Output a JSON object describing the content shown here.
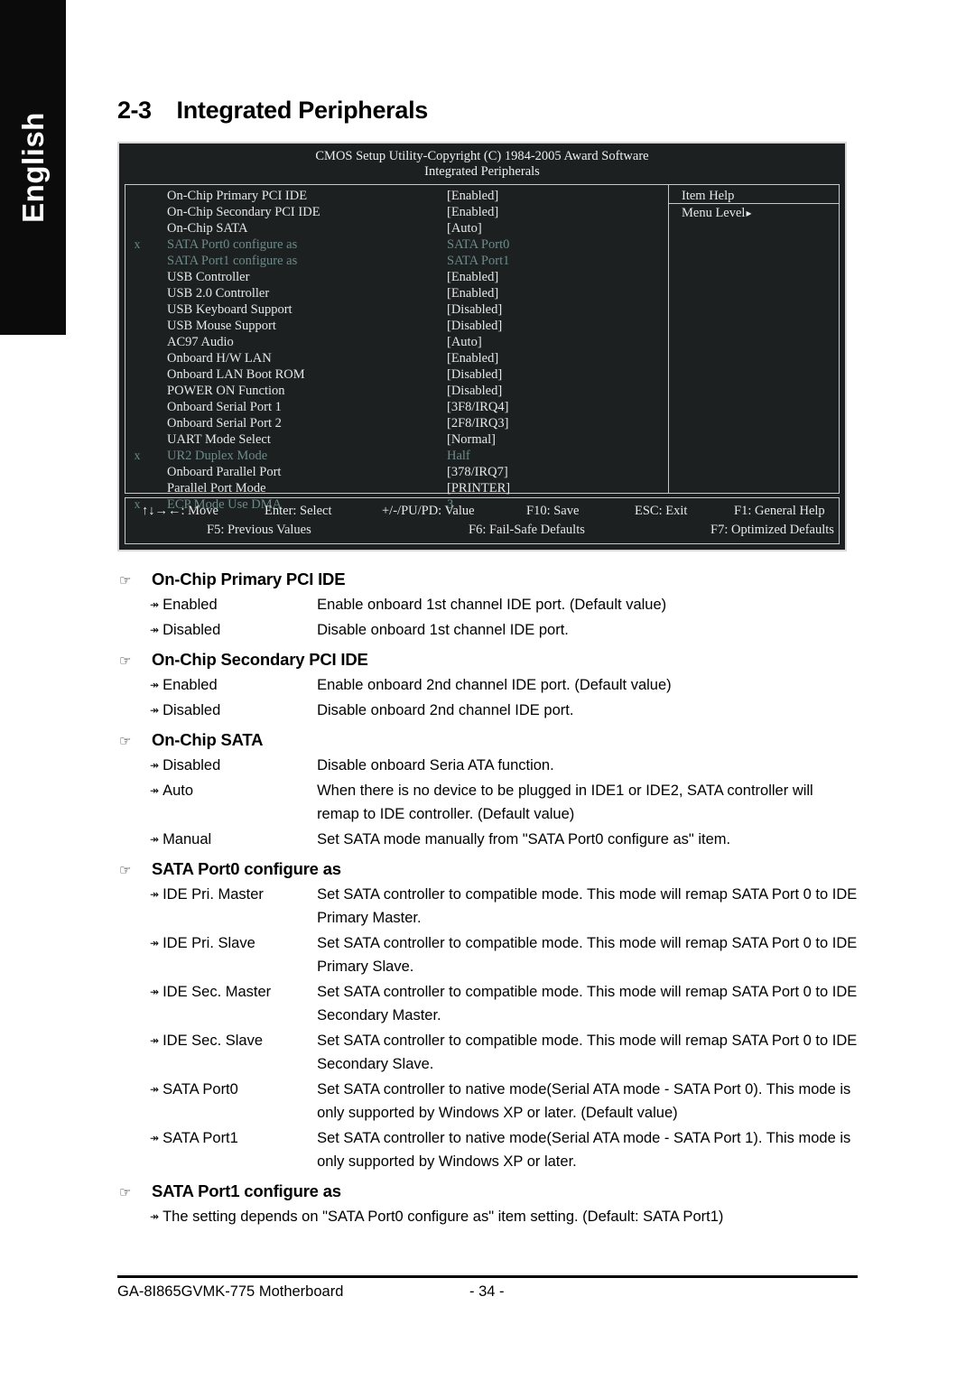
{
  "sidebar": {
    "language_tab": "English"
  },
  "section": {
    "number": "2-3",
    "title": "Integrated Peripherals"
  },
  "bios": {
    "header_line1": "CMOS Setup Utility-Copyright (C) 1984-2005 Award Software",
    "header_line2": "Integrated Peripherals",
    "help_title": "Item Help",
    "help_menu_level": "Menu Level",
    "help_menu_arrow": "▸",
    "rows": [
      {
        "x": "",
        "label": "On-Chip Primary PCI IDE",
        "value": "[Enabled]",
        "dim": false
      },
      {
        "x": "",
        "label": "On-Chip Secondary PCI IDE",
        "value": "[Enabled]",
        "dim": false
      },
      {
        "x": "",
        "label": "On-Chip SATA",
        "value": "[Auto]",
        "dim": false
      },
      {
        "x": "x",
        "label": "SATA Port0 configure as",
        "value": "SATA Port0",
        "dim": true
      },
      {
        "x": "",
        "label": "SATA Port1 configure as",
        "value": "SATA Port1",
        "dim": true
      },
      {
        "x": "",
        "label": "USB Controller",
        "value": "[Enabled]",
        "dim": false
      },
      {
        "x": "",
        "label": "USB 2.0 Controller",
        "value": "[Enabled]",
        "dim": false
      },
      {
        "x": "",
        "label": "USB Keyboard Support",
        "value": "[Disabled]",
        "dim": false
      },
      {
        "x": "",
        "label": "USB Mouse Support",
        "value": "[Disabled]",
        "dim": false
      },
      {
        "x": "",
        "label": "AC97 Audio",
        "value": "[Auto]",
        "dim": false
      },
      {
        "x": "",
        "label": "Onboard H/W LAN",
        "value": "[Enabled]",
        "dim": false
      },
      {
        "x": "",
        "label": "Onboard LAN Boot ROM",
        "value": "[Disabled]",
        "dim": false
      },
      {
        "x": "",
        "label": "POWER ON Function",
        "value": "[Disabled]",
        "dim": false
      },
      {
        "x": "",
        "label": "Onboard Serial Port 1",
        "value": "[3F8/IRQ4]",
        "dim": false
      },
      {
        "x": "",
        "label": "Onboard Serial Port 2",
        "value": "[2F8/IRQ3]",
        "dim": false
      },
      {
        "x": "",
        "label": "UART Mode Select",
        "value": "[Normal]",
        "dim": false
      },
      {
        "x": "x",
        "label": "UR2 Duplex Mode",
        "value": "Half",
        "dim": true
      },
      {
        "x": "",
        "label": "Onboard Parallel Port",
        "value": "[378/IRQ7]",
        "dim": false
      },
      {
        "x": "",
        "label": "Parallel Port Mode",
        "value": "[PRINTER]",
        "dim": false
      },
      {
        "x": "x",
        "label": "ECP Mode Use DMA",
        "value": "3",
        "dim": true
      }
    ],
    "footer_row1": [
      "↑↓→←: Move",
      "Enter: Select",
      "+/-/PU/PD: Value",
      "F10: Save",
      "ESC: Exit",
      "F1: General Help"
    ],
    "footer_row2": [
      "F5: Previous Values",
      "F6: Fail-Safe Defaults",
      "F7: Optimized Defaults"
    ]
  },
  "doc": {
    "hand_icon": "☞",
    "arrow_icon": "↠",
    "groups": [
      {
        "heading": "On-Chip Primary PCI IDE",
        "options": [
          {
            "name": "Enabled",
            "desc": "Enable onboard 1st channel IDE port. (Default value)"
          },
          {
            "name": "Disabled",
            "desc": "Disable onboard 1st channel IDE port."
          }
        ]
      },
      {
        "heading": "On-Chip Secondary PCI IDE",
        "options": [
          {
            "name": "Enabled",
            "desc": "Enable onboard 2nd channel IDE port. (Default value)"
          },
          {
            "name": "Disabled",
            "desc": "Disable onboard 2nd channel IDE port."
          }
        ]
      },
      {
        "heading": "On-Chip SATA",
        "options": [
          {
            "name": "Disabled",
            "desc": "Disable onboard Seria ATA function."
          },
          {
            "name": "Auto",
            "desc": "When there is no device to be plugged in IDE1 or IDE2, SATA controller will remap to IDE controller. (Default value)"
          },
          {
            "name": "Manual",
            "desc": "Set SATA mode manually from \"SATA Port0 configure as\" item."
          }
        ]
      },
      {
        "heading": "SATA Port0 configure as",
        "options": [
          {
            "name": "IDE Pri. Master",
            "desc": "Set SATA controller to compatible mode. This mode will remap SATA Port 0 to IDE Primary Master."
          },
          {
            "name": "IDE Pri. Slave",
            "desc": "Set SATA controller to compatible mode. This mode will remap SATA Port 0 to IDE Primary Slave."
          },
          {
            "name": "IDE Sec. Master",
            "desc": "Set SATA controller to compatible mode. This mode will remap SATA Port 0 to IDE Secondary Master."
          },
          {
            "name": "IDE Sec. Slave",
            "desc": "Set SATA controller to compatible mode. This mode will remap SATA Port 0 to IDE Secondary Slave."
          },
          {
            "name": "SATA Port0",
            "desc": "Set SATA controller to native mode(Serial ATA mode - SATA Port 0). This mode is only supported by Windows XP or later. (Default value)"
          },
          {
            "name": "SATA Port1",
            "desc": "Set SATA controller to native mode(Serial ATA mode - SATA Port 1). This mode is only supported by Windows XP or later."
          }
        ]
      },
      {
        "heading": "SATA Port1 configure as",
        "options": [
          {
            "name": "",
            "desc": "The setting depends on \"SATA Port0 configure as\" item setting. (Default: SATA Port1)",
            "wide": true
          }
        ]
      }
    ]
  },
  "footer": {
    "board": "GA-8I865GVMK-775 Motherboard",
    "page": "- 34 -"
  }
}
